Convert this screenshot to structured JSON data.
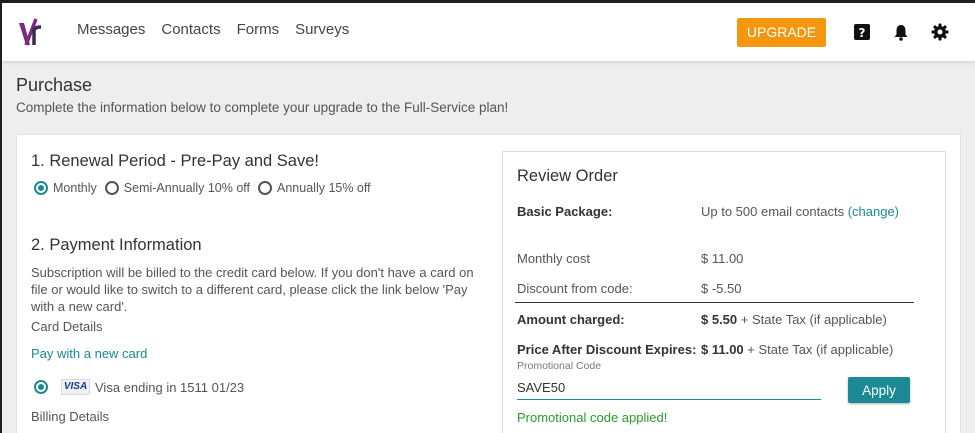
{
  "header": {
    "nav": [
      "Messages",
      "Contacts",
      "Forms",
      "Surveys"
    ],
    "upgrade_label": "UPGRADE",
    "icons": [
      "help-icon",
      "bell-icon",
      "gear-icon"
    ],
    "accent_color": "#f5960f"
  },
  "page": {
    "title": "Purchase",
    "subtitle": "Complete the information below to complete your upgrade to the Full-Service plan!"
  },
  "renewal": {
    "heading": "1. Renewal Period - Pre-Pay and Save!",
    "options": [
      "Monthly",
      "Semi-Annually 10% off",
      "Annually 15% off"
    ],
    "selected": "Monthly"
  },
  "payment": {
    "heading": "2. Payment Information",
    "description": "Subscription will be billed to the credit card below. If you don't have a card on file or would like to switch to a different card, please click the link below 'Pay with a new card'.",
    "card_details_label": "Card Details",
    "new_card_link": "Pay with a new card",
    "card_brand": "VISA",
    "card_text": "Visa ending in 1511 01/23",
    "billing_label": "Billing Details"
  },
  "review": {
    "title": "Review Order",
    "package_label": "Basic Package:",
    "package_value": "Up to 500 email contacts",
    "change_link": "(change)",
    "monthly_label": "Monthly cost",
    "monthly_value": "$ 11.00",
    "discount_label": "Discount from code:",
    "discount_value": "$ -5.50",
    "charged_label": "Amount charged:",
    "charged_amount": "$ 5.50",
    "charged_suffix": " + State Tax (if applicable)",
    "after_label": "Price After Discount Expires:",
    "after_amount": "$ 11.00",
    "after_suffix": " + State Tax (if applicable)",
    "promo_label": "Promotional Code",
    "promo_value": "SAVE50",
    "apply_label": "Apply",
    "promo_status": "Promotional code applied!"
  },
  "colors": {
    "teal": "#1b8a95",
    "success": "#2a9d2a"
  }
}
